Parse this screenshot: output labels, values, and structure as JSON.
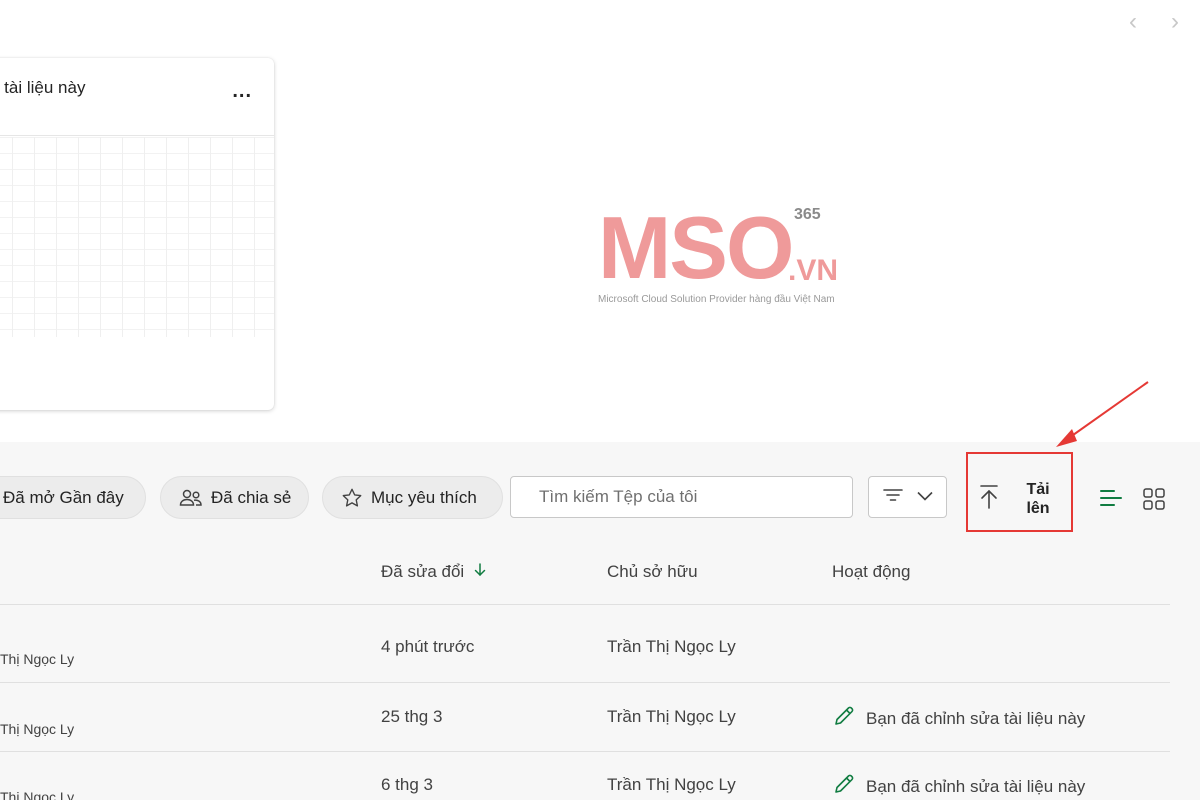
{
  "nav": {
    "prev_glyph": "‹",
    "next_glyph": "›"
  },
  "card": {
    "title": "n tài liệu này",
    "more": "..."
  },
  "logo": {
    "main": "MSO",
    "badge": "365",
    "suffix": ".VN",
    "tagline": "Microsoft Cloud Solution Provider hàng đầu Việt Nam"
  },
  "chips": {
    "recent": "Đã mở Gần đây",
    "shared": "Đã chia sẻ",
    "favorites": "Mục yêu thích"
  },
  "search": {
    "placeholder": "Tìm kiếm Tệp của tôi"
  },
  "upload": {
    "label": "Tải lên"
  },
  "columns": {
    "modified": "Đã sửa đổi",
    "owner": "Chủ sở hữu",
    "activity": "Hoạt động"
  },
  "rows": [
    {
      "owner_short": "Thị Ngọc Ly",
      "modified": "4 phút trước",
      "owner": "Trần Thị Ngọc Ly",
      "activity": ""
    },
    {
      "owner_short": "Thị Ngọc Ly",
      "modified": "25 thg 3",
      "owner": "Trần Thị Ngọc Ly",
      "activity": "Bạn đã chỉnh sửa tài liệu này"
    },
    {
      "owner_short": "Thị Ngọc Ly",
      "modified": "6 thg 3",
      "owner": "Trần Thị Ngọc Ly",
      "activity": "Bạn đã chỉnh sửa tài liệu này"
    }
  ],
  "colors": {
    "accent": "#107c41",
    "highlight": "#e53935",
    "logo": "#ef9a9a"
  }
}
